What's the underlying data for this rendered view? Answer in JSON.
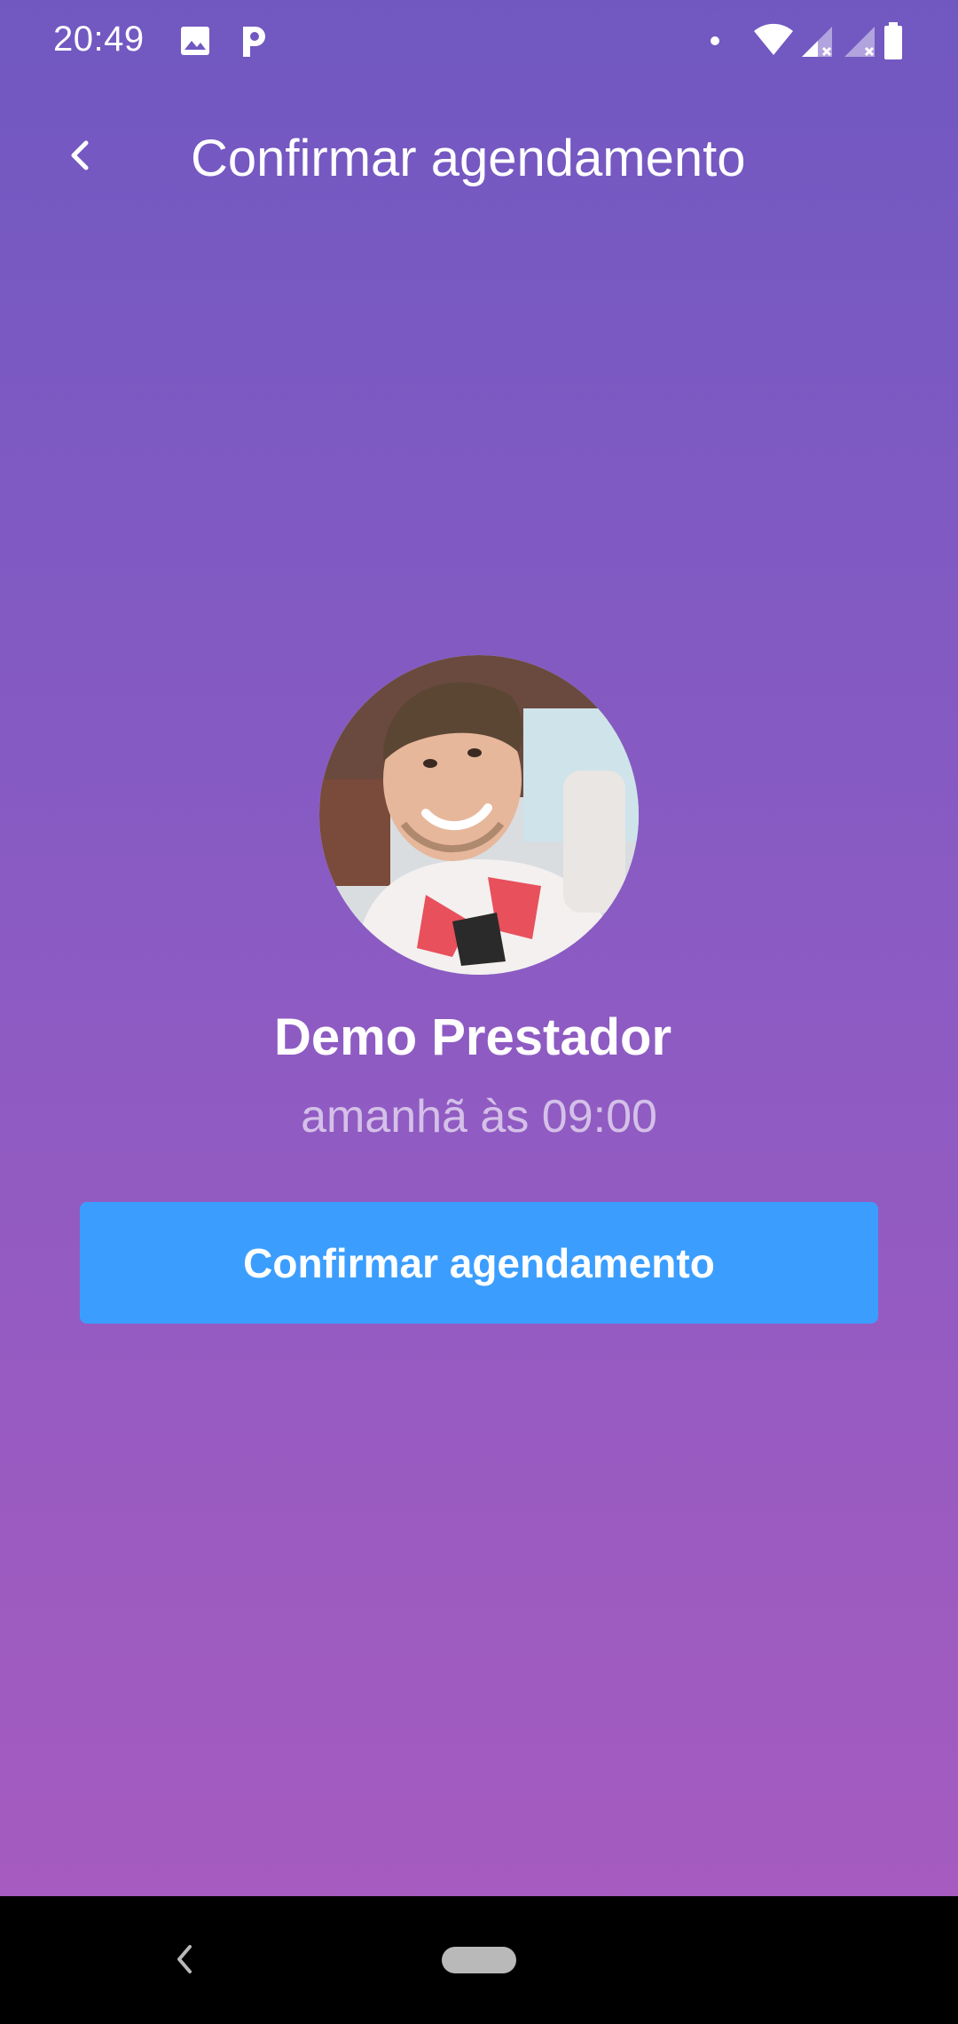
{
  "status_bar": {
    "time": "20:49",
    "icons": [
      "image-icon",
      "p-app-icon",
      "notification-dot-icon",
      "wifi-icon",
      "signal-icon",
      "signal-icon",
      "battery-icon"
    ]
  },
  "app_bar": {
    "back_icon": "chevron-left-icon",
    "title": "Confirmar agendamento"
  },
  "provider": {
    "avatar": "avatar-photo",
    "name": "Demo Prestador",
    "time": "amanhã às 09:00"
  },
  "confirm_button": {
    "label": "Confirmar agendamento"
  },
  "nav_bar": {
    "back_icon": "nav-back-icon",
    "home_icon": "home-pill-icon"
  },
  "colors": {
    "gradient_top": "#7158c1",
    "gradient_bottom": "#a95bbf",
    "button": "#3b9eff",
    "text": "#ffffff"
  }
}
